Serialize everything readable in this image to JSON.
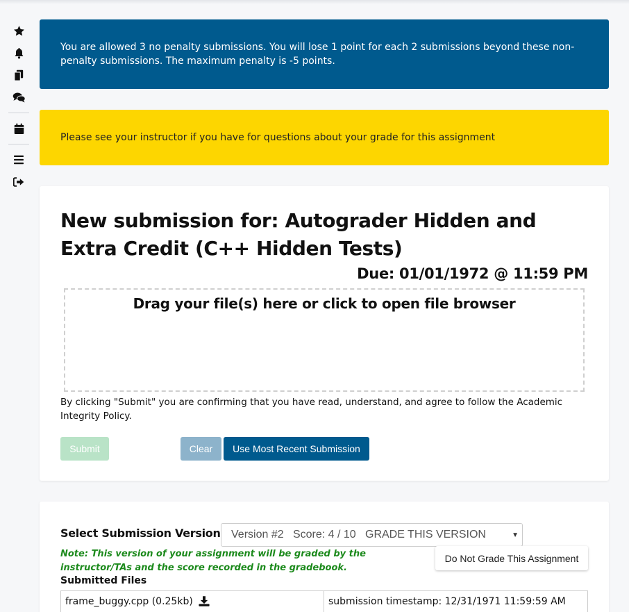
{
  "sidebar": {
    "icons": [
      "star-icon",
      "bell-icon",
      "copy-icon",
      "comments-icon",
      "calendar-icon",
      "bars-icon",
      "sign-out-icon"
    ]
  },
  "banners": {
    "penalty": "You are allowed 3 no penalty submissions. You will lose 1 point for each 2 submissions beyond these non-penalty submissions. The maximum penalty is -5 points.",
    "instructor": "Please see your instructor if you have for questions about your grade for this assignment"
  },
  "submission": {
    "title": "New submission for: Autograder Hidden and Extra Credit (C++ Hidden Tests)",
    "due": "Due: 01/01/1972 @ 11:59 PM",
    "dropzone_text": "Drag your file(s) here or click to open file browser",
    "agreement": "By clicking \"Submit\" you are confirming that you have read, understand, and agree to follow the Academic Integrity Policy.",
    "submit_label": "Submit",
    "clear_label": "Clear",
    "recent_label": "Use Most Recent Submission"
  },
  "versions": {
    "select_label": "Select Submission Version:",
    "selected_option": "Version #2   Score: 4 / 10   GRADE THIS VERSION",
    "note": "Note: This version of your assignment will be graded by the instructor/TAs and the score recorded in the gradebook.",
    "no_grade_label": "Do Not Grade This Assignment",
    "files_label": "Submitted Files",
    "file_name": "frame_buggy.cpp (0.25kb)",
    "timestamp": "submission timestamp: 12/31/1971 11:59:59 AM"
  },
  "colors": {
    "blue_banner": "#005a8e",
    "yellow_banner": "#fdd600",
    "note_green": "#1c8a1c",
    "submit_disabled": "#b9e3c7",
    "clear_disabled": "#8db3cb"
  }
}
